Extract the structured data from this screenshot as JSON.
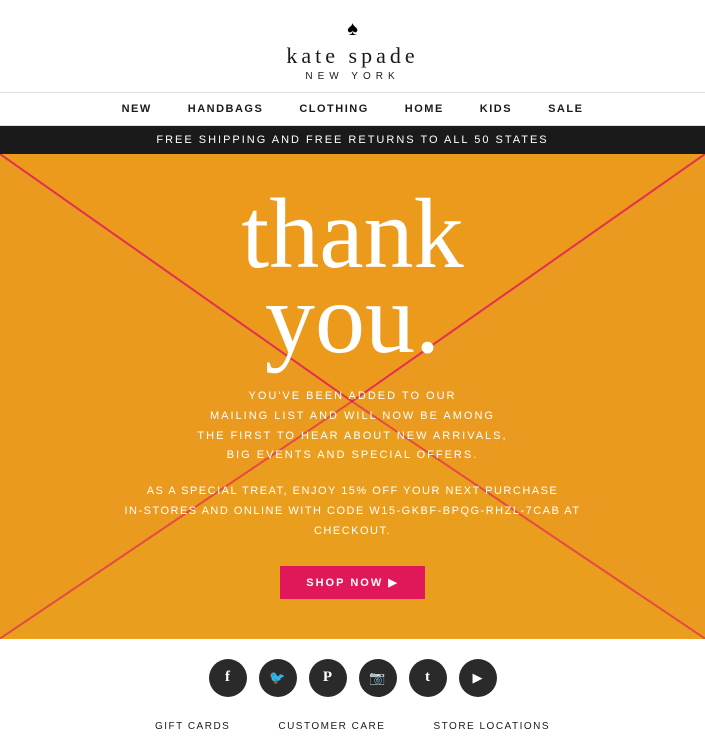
{
  "header": {
    "spade_icon": "♠",
    "brand_name": "kate spade",
    "sub_title": "NEW YORK"
  },
  "nav": {
    "items": [
      {
        "label": "NEW",
        "id": "nav-new"
      },
      {
        "label": "HANDBAGS",
        "id": "nav-handbags"
      },
      {
        "label": "CLOTHING",
        "id": "nav-clothing"
      },
      {
        "label": "HOME",
        "id": "nav-home"
      },
      {
        "label": "KIDS",
        "id": "nav-kids"
      },
      {
        "label": "SALE",
        "id": "nav-sale"
      }
    ]
  },
  "banner": {
    "text": "FREE SHIPPING AND FREE RETURNS TO ALL 50 STATES"
  },
  "hero": {
    "thank_line1": "thank",
    "thank_line2": "you.",
    "body_text_line1": "YOU'VE BEEN ADDED TO OUR",
    "body_text_line2": "MAILING LIST AND WILL NOW BE AMONG",
    "body_text_line3": "THE FIRST TO HEAR ABOUT NEW ARRIVALS,",
    "body_text_line4": "BIG EVENTS AND SPECIAL OFFERS.",
    "promo_text_line1": "AS A SPECIAL TREAT, ENJOY 15% OFF YOUR NEXT PURCHASE",
    "promo_text_line2": "IN-STORES AND ONLINE WITH CODE W15-GKBF-BPQG-RHZL-7CAB AT",
    "promo_text_line3": "CHECKOUT.",
    "shop_now_label": "SHOP NOW ▶",
    "bg_color": "#F5A623",
    "envelope_color": "#e8961a",
    "envelope_line_color": "#e0185a"
  },
  "social": {
    "icons": [
      {
        "name": "facebook-icon",
        "symbol": "f"
      },
      {
        "name": "twitter-icon",
        "symbol": "t"
      },
      {
        "name": "pinterest-icon",
        "symbol": "p"
      },
      {
        "name": "instagram-icon",
        "symbol": "📷"
      },
      {
        "name": "tumblr-icon",
        "symbol": "t"
      },
      {
        "name": "youtube-icon",
        "symbol": "▶"
      }
    ]
  },
  "footer": {
    "links": [
      {
        "label": "GIFT CARDS",
        "id": "gift-cards-link"
      },
      {
        "label": "CUSTOMER CARE",
        "id": "customer-care-link"
      },
      {
        "label": "STORE LOCATIONS",
        "id": "store-locations-link"
      }
    ]
  }
}
